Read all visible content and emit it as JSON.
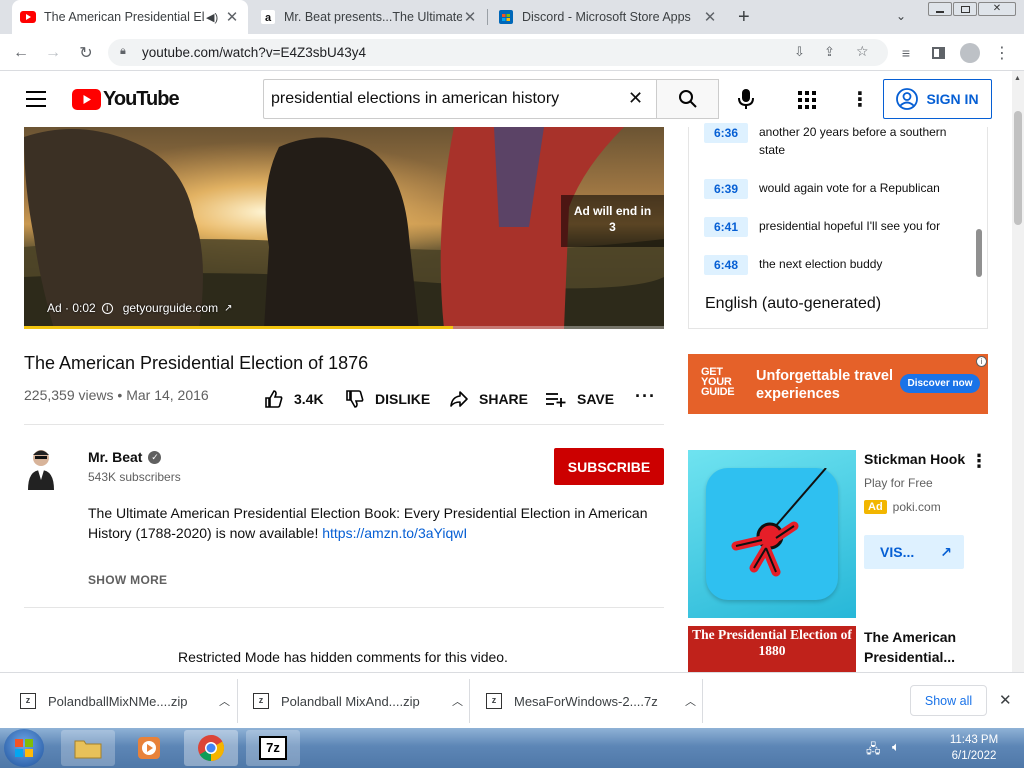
{
  "browser": {
    "tabs": [
      {
        "title": "The American Presidential El",
        "active": true
      },
      {
        "title": "Mr. Beat presents...The Ultimate",
        "active": false
      },
      {
        "title": "Discord - Microsoft Store Apps",
        "active": false
      }
    ],
    "url": "youtube.com/watch?v=E4Z3sbU43y4"
  },
  "youtube": {
    "logo_text": "YouTube",
    "search_query": "presidential elections in american history",
    "sign_in": "SIGN IN",
    "video": {
      "ad_label": "Ad · 0:02",
      "ad_domain": "getyourguide.com",
      "ad_skip": "Ad will end in 3",
      "ad_progress": 0.67,
      "title": "The American Presidential Election of 1876",
      "views": "225,359 views",
      "date": "Mar 14, 2016",
      "likes": "3.4K",
      "dislike": "DISLIKE",
      "share": "SHARE",
      "save": "SAVE"
    },
    "channel": {
      "name": "Mr. Beat",
      "subscribers": "543K subscribers",
      "subscribe": "SUBSCRIBE",
      "description": "The Ultimate American Presidential Election Book: Every Presidential Election in American History (1788-2020) is now available!",
      "link": "https://amzn.to/3aYiqwI",
      "show_more": "SHOW MORE"
    },
    "comments_notice": "Restricted Mode has hidden comments for this video.",
    "transcript": {
      "rows": [
        {
          "time": "6:36",
          "text": "another 20 years before a southern state"
        },
        {
          "time": "6:39",
          "text": "would again vote for a Republican"
        },
        {
          "time": "6:41",
          "text": "presidential hopeful I'll see you for"
        },
        {
          "time": "6:48",
          "text": "the next election buddy"
        }
      ],
      "language": "English (auto-generated)"
    },
    "ad_banner": {
      "brand": "GET YOUR GUIDE",
      "headline": "Unforgettable travel experiences",
      "cta": "Discover now"
    },
    "sidebar_ad": {
      "title": "Stickman Hook",
      "subtitle": "Play for Free",
      "ad_badge": "Ad",
      "domain": "poki.com",
      "visit": "VIS..."
    },
    "recommended": {
      "thumb_text": "The Presidential Election of 1880",
      "title": "The American Presidential..."
    }
  },
  "downloads": {
    "items": [
      "PolandballMixNMe....zip",
      "Polandball MixAnd....zip",
      "MesaForWindows-2....7z"
    ],
    "show_all": "Show all"
  },
  "taskbar": {
    "time": "11:43 PM",
    "date": "6/1/2022"
  },
  "colors": {
    "youtube_red": "#ff0000",
    "subscribe_red": "#cc0000",
    "link_blue": "#065fd4",
    "ad_orange": "#e56129"
  }
}
